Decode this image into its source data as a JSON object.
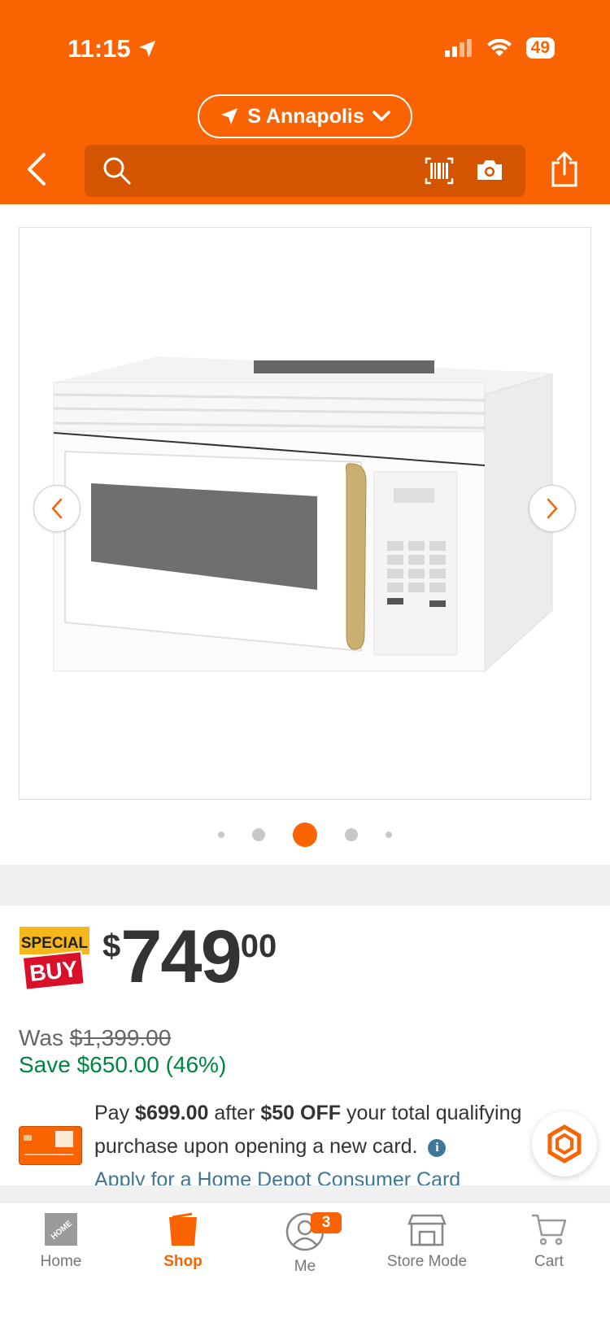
{
  "status_bar": {
    "time": "11:15",
    "battery": "49"
  },
  "header": {
    "store_name": "S Annapolis",
    "search_placeholder": ""
  },
  "product": {
    "image_alt": "White over-the-range microwave with gold handle",
    "gallery": {
      "dot_count": 5,
      "active_index": 2
    }
  },
  "pricing": {
    "badge_top": "SPECIAL",
    "badge_bottom": "BUY",
    "currency_symbol": "$",
    "price_whole": "749",
    "price_cents": "00",
    "was_label": "Was",
    "was_price": "$1,399.00",
    "save_text": "Save $650.00 (46%)"
  },
  "card_promo": {
    "pay_prefix": "Pay",
    "pay_amount": "$699.00",
    "after": "after",
    "off_amount": "$50 OFF",
    "rest": "your total qualifying purchase upon opening a new card.",
    "info_glyph": "i",
    "apply_link": "Apply for a Home Depot Consumer Card"
  },
  "tabbar": {
    "tabs": [
      {
        "label": "Home",
        "icon": "home-depot-logo-icon"
      },
      {
        "label": "Shop",
        "icon": "bucket-icon"
      },
      {
        "label": "Me",
        "icon": "user-icon",
        "badge": "3"
      },
      {
        "label": "Store Mode",
        "icon": "store-icon"
      },
      {
        "label": "Cart",
        "icon": "cart-icon"
      }
    ]
  },
  "colors": {
    "brand_orange": "#f96302",
    "save_green": "#00853e",
    "link_blue": "#3e7697"
  }
}
